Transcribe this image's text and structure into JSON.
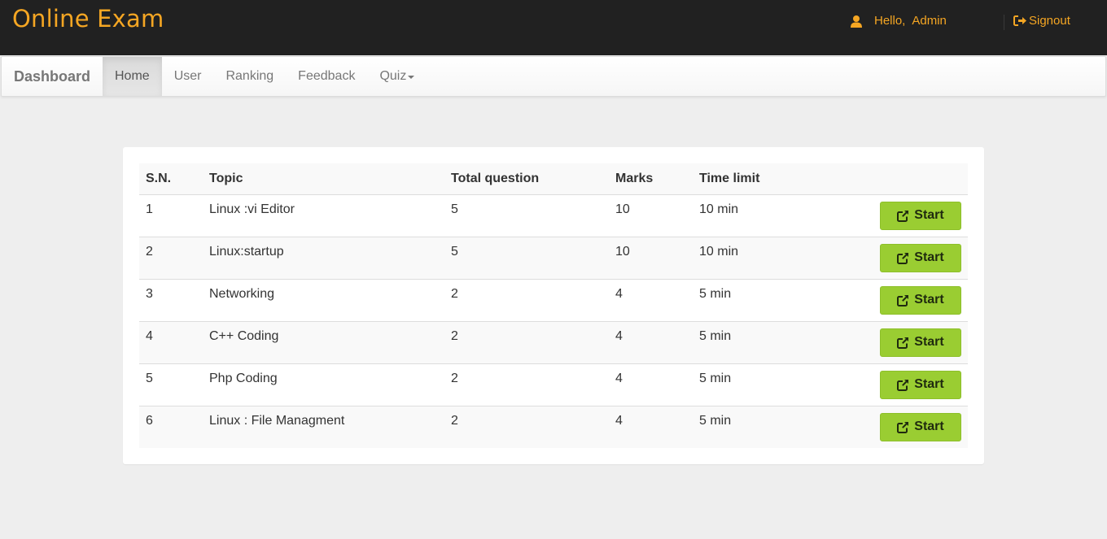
{
  "header": {
    "logo": "Online Exam",
    "greeting": "Hello,",
    "username": "Admin",
    "signout_label": "Signout",
    "user_icon": "user-icon",
    "signout_icon": "signout-icon",
    "accent_color": "#f5a623"
  },
  "nav": {
    "brand": "Dashboard",
    "items": [
      {
        "label": "Home",
        "active": true
      },
      {
        "label": "User",
        "active": false
      },
      {
        "label": "Ranking",
        "active": false
      },
      {
        "label": "Feedback",
        "active": false
      },
      {
        "label": "Quiz",
        "active": false,
        "dropdown": true
      }
    ]
  },
  "table": {
    "columns": [
      "S.N.",
      "Topic",
      "Total question",
      "Marks",
      "Time limit"
    ],
    "rows": [
      {
        "sn": "1",
        "topic": "Linux :vi Editor",
        "total": "5",
        "marks": "10",
        "time": "10 min",
        "action": "Start"
      },
      {
        "sn": "2",
        "topic": "Linux:startup",
        "total": "5",
        "marks": "10",
        "time": "10 min",
        "action": "Start"
      },
      {
        "sn": "3",
        "topic": "Networking",
        "total": "2",
        "marks": "4",
        "time": "5 min",
        "action": "Start"
      },
      {
        "sn": "4",
        "topic": "C++ Coding",
        "total": "2",
        "marks": "4",
        "time": "5 min",
        "action": "Start"
      },
      {
        "sn": "5",
        "topic": "Php Coding",
        "total": "2",
        "marks": "4",
        "time": "5 min",
        "action": "Start"
      },
      {
        "sn": "6",
        "topic": "Linux : File Managment",
        "total": "2",
        "marks": "4",
        "time": "5 min",
        "action": "Start"
      }
    ],
    "button_color": "#9acd32",
    "button_icon": "external-link-icon"
  }
}
